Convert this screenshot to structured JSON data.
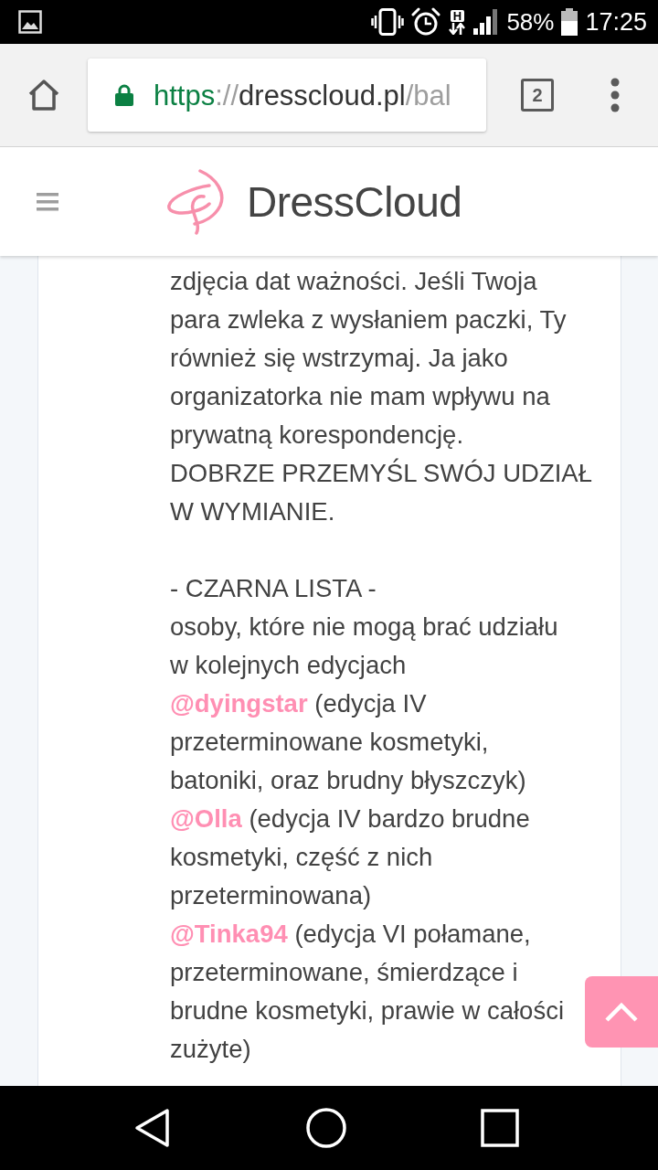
{
  "status_bar": {
    "network_type": "H",
    "battery": "58%",
    "time": "17:25"
  },
  "browser": {
    "url": {
      "scheme": "https",
      "separator": "://",
      "host": "dresscloud.pl",
      "path": "/bal"
    },
    "tab_count": "2"
  },
  "site_header": {
    "brand": "DressCloud"
  },
  "post": {
    "blocks": [
      {
        "kind": "paragraph",
        "lines": [
          "zdjęcia dat ważności. Jeśli Twoja",
          "para zwleka z wysłaniem paczki, Ty",
          "również się wstrzymaj. Ja jako",
          "organizatorka nie mam wpływu na",
          "prywatną korespondencję."
        ]
      },
      {
        "kind": "paragraph",
        "lines": [
          "DOBRZE PRZEMYŚL SWÓJ UDZIAŁ",
          "W WYMIANIE."
        ]
      },
      {
        "kind": "heading",
        "lines": [
          "- CZARNA LISTA -"
        ]
      },
      {
        "kind": "paragraph",
        "lines": [
          "osoby, które nie mogą brać udziału",
          "w kolejnych edycjach"
        ]
      },
      {
        "kind": "entry",
        "mention": "@dyingstar",
        "lines": [
          "(edycja IV",
          "przeterminowane kosmetyki,",
          "batoniki, oraz brudny błyszczyk)"
        ]
      },
      {
        "kind": "entry",
        "mention": "@Olla",
        "lines": [
          "(edycja IV bardzo brudne",
          "kosmetyki, część z nich",
          "przeterminowana)"
        ]
      },
      {
        "kind": "entry",
        "mention": "@Tinka94",
        "lines": [
          "(edycja VI połamane,",
          "przeterminowane, śmierdzące i",
          "brudne kosmetyki, prawie w całości",
          "zużyte)"
        ]
      }
    ]
  }
}
